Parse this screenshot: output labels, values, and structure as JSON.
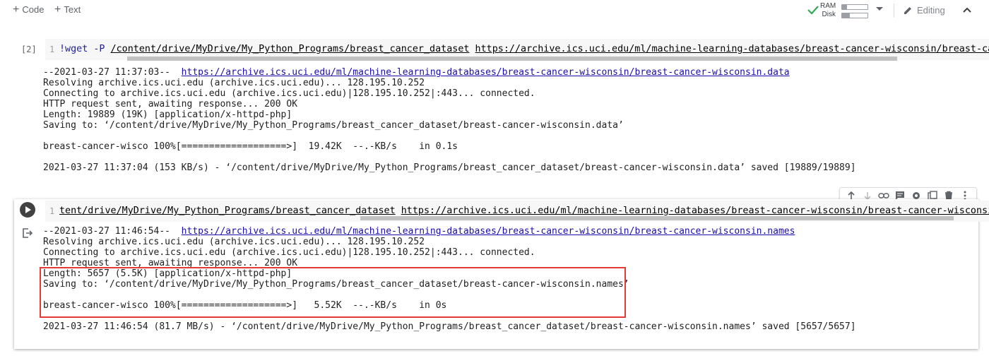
{
  "toolbar": {
    "code_label": "Code",
    "text_label": "Text",
    "ram_label": "RAM",
    "disk_label": "Disk",
    "ram_usage": 0.2,
    "disk_usage": 0.3,
    "editing_label": "Editing"
  },
  "cells": [
    {
      "exec_count": "[2]",
      "line_number": "1",
      "code_cmd": "!wget -P ",
      "code_path": "/content/drive/MyDrive/My_Python_Programs/breast_cancer_dataset",
      "code_url": "https://archive.ics.uci.edu/ml/machine-learning-databases/breast-cancer-wisconsin/breast-cancer-wiscor",
      "output_url": "https://archive.ics.uci.edu/ml/machine-learning-databases/breast-cancer-wisconsin/breast-cancer-wisconsin.data",
      "output": {
        "line1_prefix": "--2021-03-27 11:37:03--  ",
        "line2": "Resolving archive.ics.uci.edu (archive.ics.uci.edu)... 128.195.10.252",
        "line3": "Connecting to archive.ics.uci.edu (archive.ics.uci.edu)|128.195.10.252|:443... connected.",
        "line4": "HTTP request sent, awaiting response... 200 OK",
        "line5": "Length: 19889 (19K) [application/x-httpd-php]",
        "line6": "Saving to: ‘/content/drive/MyDrive/My_Python_Programs/breast_cancer_dataset/breast-cancer-wisconsin.data’",
        "line7": "breast-cancer-wisco 100%[===================>]  19.42K  --.-KB/s    in 0.1s",
        "line8": "2021-03-27 11:37:04 (153 KB/s) - ‘/content/drive/MyDrive/My_Python_Programs/breast_cancer_dataset/breast-cancer-wisconsin.data’ saved [19889/19889]"
      }
    },
    {
      "line_number": "1",
      "code_path": "tent/drive/MyDrive/My_Python_Programs/breast_cancer_dataset",
      "code_url": "https://archive.ics.uci.edu/ml/machine-learning-databases/breast-cancer-wisconsin/breast-cancer-wisconsin.names",
      "output_url": "https://archive.ics.uci.edu/ml/machine-learning-databases/breast-cancer-wisconsin/breast-cancer-wisconsin.names",
      "output": {
        "line1_prefix": "--2021-03-27 11:46:54--  ",
        "line2": "Resolving archive.ics.uci.edu (archive.ics.uci.edu)... 128.195.10.252",
        "line3": "Connecting to archive.ics.uci.edu (archive.ics.uci.edu)|128.195.10.252|:443... connected.",
        "line4": "HTTP request sent, awaiting response... 200 OK",
        "line5": "Length: 5657 (5.5K) [application/x-httpd-php]",
        "line6": "Saving to: ‘/content/drive/MyDrive/My_Python_Programs/breast_cancer_dataset/breast-cancer-wisconsin.names’",
        "line7": "breast-cancer-wisco 100%[===================>]   5.52K  --.-KB/s    in 0s",
        "line8": "2021-03-27 11:46:54 (81.7 MB/s) - ‘/content/drive/MyDrive/My_Python_Programs/breast_cancer_dataset/breast-cancer-wisconsin.names’ saved [5657/5657]"
      }
    }
  ],
  "colors": {
    "highlight": "#e53935",
    "link": "#1a0dab",
    "check": "#34a853"
  }
}
